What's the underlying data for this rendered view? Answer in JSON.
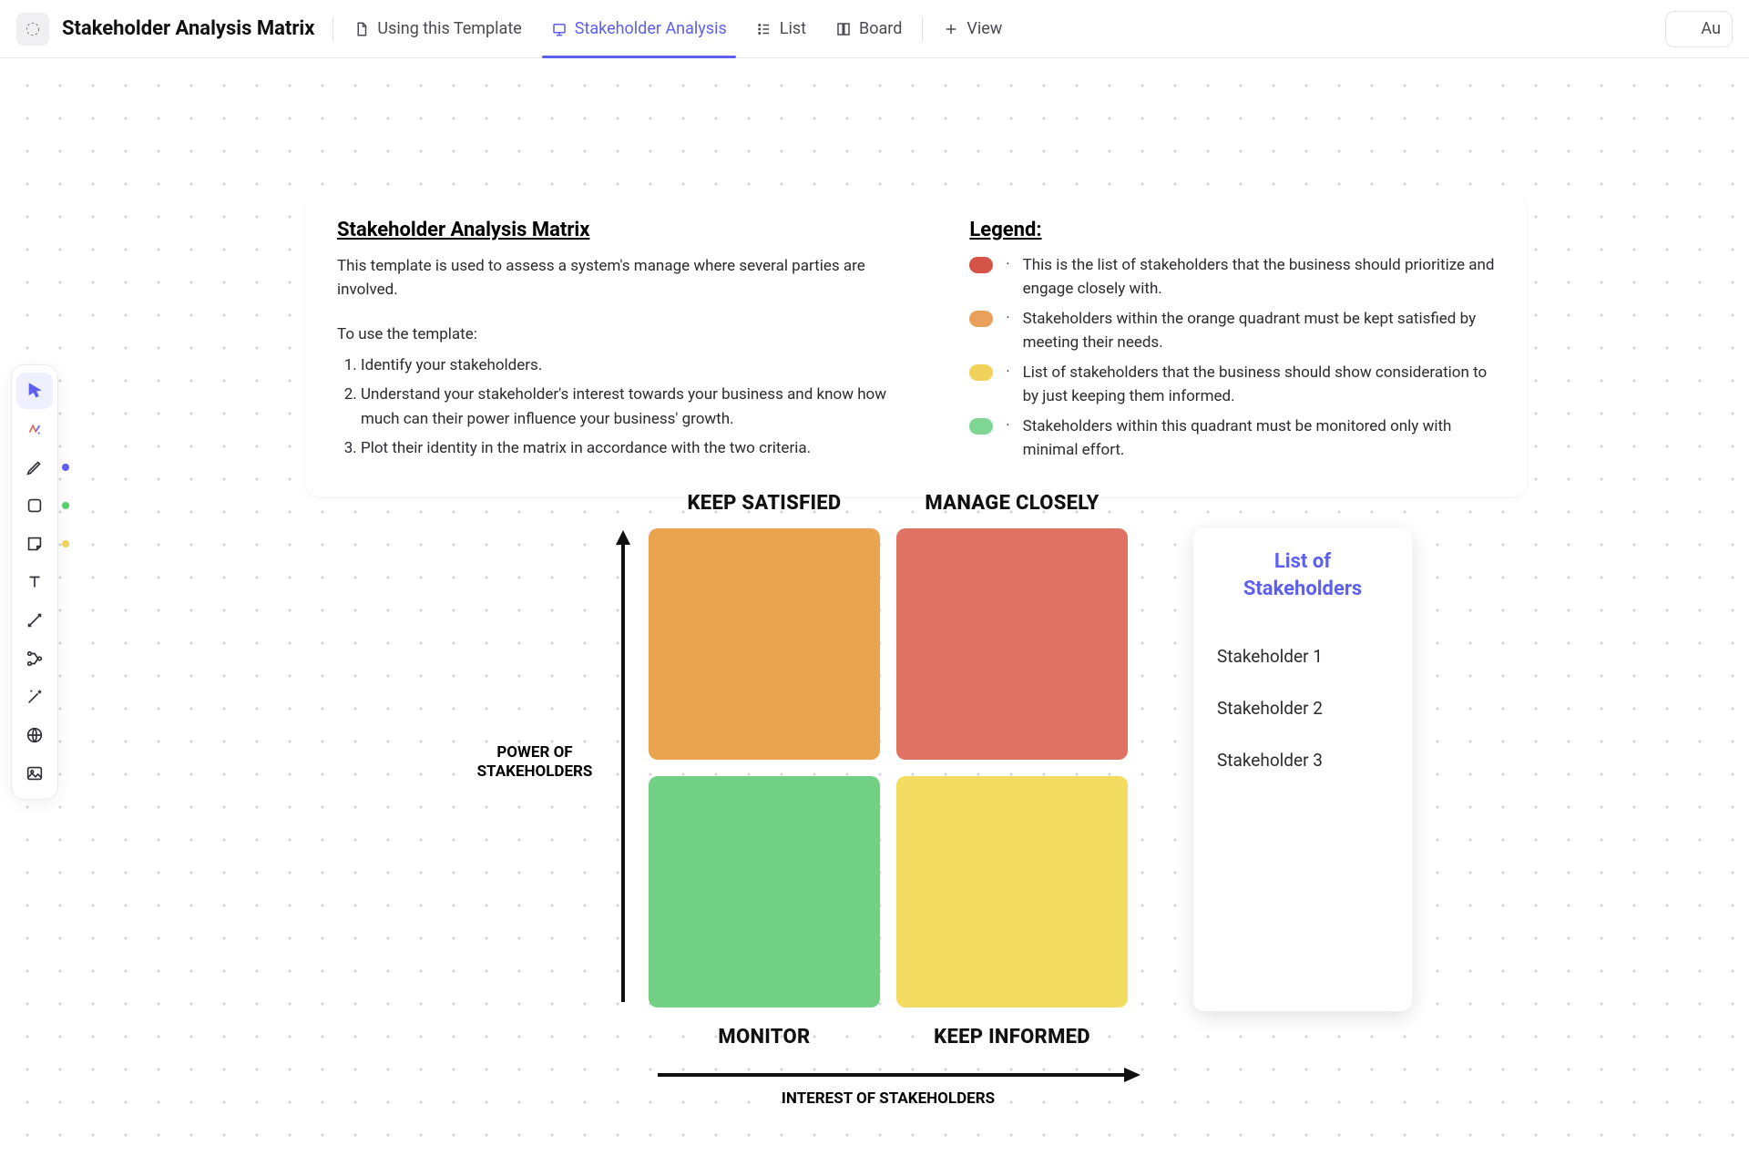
{
  "header": {
    "title": "Stakeholder Analysis Matrix",
    "tabs": [
      {
        "label": "Using this Template"
      },
      {
        "label": "Stakeholder Analysis"
      },
      {
        "label": "List"
      },
      {
        "label": "Board"
      },
      {
        "label": "View"
      }
    ],
    "ai_label": "Au"
  },
  "info": {
    "title": "Stakeholder Analysis Matrix",
    "intro": "This template is used to assess a system's manage where several parties are involved.",
    "lead": "To use the template:",
    "steps": [
      "Identify your stakeholders.",
      "Understand your stakeholder's interest towards your business and know how much can their power influence your business' growth.",
      "Plot their identity in the matrix in accordance with the two criteria."
    ]
  },
  "legend": {
    "title": "Legend:",
    "items": [
      {
        "color": "#d55448",
        "text": "This is the list of stakeholders that the business should prioritize and engage closely with."
      },
      {
        "color": "#e8a05a",
        "text": "Stakeholders within the orange quadrant must be kept satisfied by meeting their needs."
      },
      {
        "color": "#f0d15a",
        "text": "List of stakeholders that the business should show consideration to by just keeping them informed."
      },
      {
        "color": "#7ed694",
        "text": "Stakeholders within this quadrant must be monitored only with minimal effort."
      }
    ]
  },
  "matrix": {
    "y_axis": "POWER OF STAKEHOLDERS",
    "x_axis": "INTEREST OF STAKEHOLDERS",
    "quadrants": {
      "top_left": {
        "label": "KEEP SATISFIED",
        "color": "#eaa450"
      },
      "top_right": {
        "label": "MANAGE CLOSELY",
        "color": "#e07264"
      },
      "bot_left": {
        "label": "MONITOR",
        "color": "#72d084"
      },
      "bot_right": {
        "label": "KEEP INFORMED",
        "color": "#f2dd62"
      }
    }
  },
  "stakeholders": {
    "title": "List of Stakeholders",
    "items": [
      "Stakeholder 1",
      "Stakeholder 2",
      "Stakeholder 3"
    ]
  },
  "tool_dots": {
    "pen": "#5d5fef",
    "shape": "#58d06a",
    "sticky": "#f0d15a"
  }
}
